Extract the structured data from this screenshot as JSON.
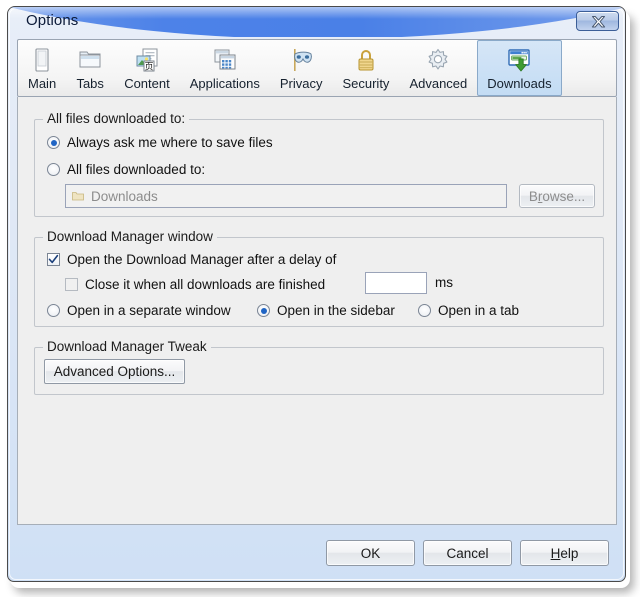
{
  "window": {
    "title": "Options",
    "close_button_label": "Close"
  },
  "tabs": [
    {
      "label": "Main",
      "icon": "main-window-icon",
      "selected": false
    },
    {
      "label": "Tabs",
      "icon": "folder-tabs-icon",
      "selected": false
    },
    {
      "label": "Content",
      "icon": "content-page-icon",
      "selected": false
    },
    {
      "label": "Applications",
      "icon": "applications-icon",
      "selected": false
    },
    {
      "label": "Privacy",
      "icon": "privacy-mask-icon",
      "selected": false
    },
    {
      "label": "Security",
      "icon": "security-lock-icon",
      "selected": false
    },
    {
      "label": "Advanced",
      "icon": "advanced-gear-icon",
      "selected": false
    },
    {
      "label": "Downloads",
      "icon": "downloads-icon",
      "selected": true
    }
  ],
  "groups": {
    "download_location": {
      "legend": "All files downloaded to:",
      "radios": [
        {
          "label": "Always ask me where to save files",
          "checked": true
        },
        {
          "label": "All files downloaded to:",
          "checked": false
        }
      ],
      "path_field": {
        "value": "Downloads",
        "icon": "folder-icon",
        "disabled": true
      },
      "browse_button": {
        "label": "Browse...",
        "accesskey": "r",
        "disabled": true
      }
    },
    "manager_window": {
      "legend": "Download Manager window",
      "open_delay": {
        "label": "Open the Download Manager after a delay of",
        "checked": true,
        "value": "",
        "unit": "ms"
      },
      "close_when_finished": {
        "label": "Close it when all downloads are finished",
        "checked": false,
        "disabled": true
      },
      "open_mode_radios": [
        {
          "label": "Open in a separate window",
          "checked": false
        },
        {
          "label": "Open in the sidebar",
          "checked": true
        },
        {
          "label": "Open in a tab",
          "checked": false
        }
      ]
    },
    "tweak": {
      "legend": "Download Manager Tweak",
      "advanced_button": {
        "label": "Advanced Options..."
      }
    }
  },
  "footer": {
    "ok": "OK",
    "cancel": "Cancel",
    "help": "Help",
    "help_accesskey": "H"
  },
  "colors": {
    "titlebar_blue": "#4a80e7",
    "selected_tab": "#c3dcf4",
    "radio_dot": "#1f64c4",
    "pane_bg": "#efefef"
  }
}
